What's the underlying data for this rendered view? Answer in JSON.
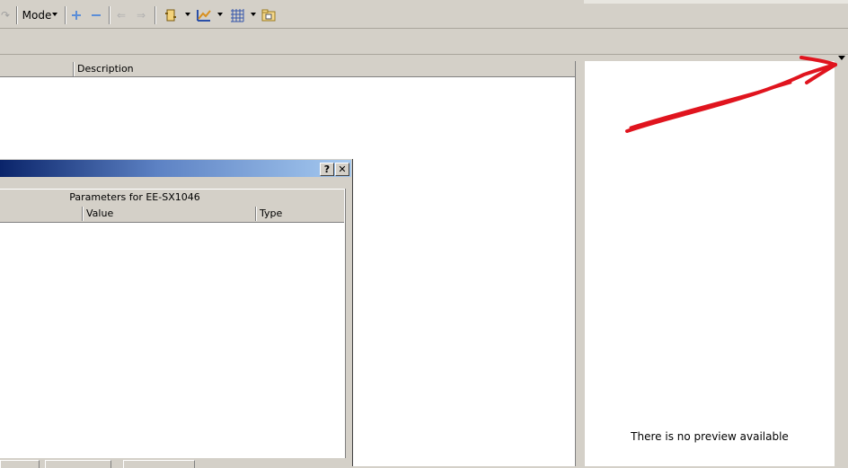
{
  "toolbar": {
    "mode_label": "Mode",
    "buttons": [
      "redo-icon",
      "zoom-in-icon",
      "zoom-out-icon",
      "back-icon",
      "forward-icon",
      "component-icon",
      "graph-icon",
      "grid-icon",
      "folder-icon"
    ]
  },
  "list": {
    "columns": [
      "Description"
    ]
  },
  "dialog": {
    "help_button": "?",
    "close_button": "✕",
    "parameters_title": "Parameters for EE-SX1046",
    "columns": [
      "Value",
      "Type"
    ]
  },
  "preview": {
    "message": "There is no preview available"
  },
  "colors": {
    "annotation": "#e0141e",
    "titlebar_start": "#0a246a",
    "titlebar_end": "#a6caf0"
  }
}
